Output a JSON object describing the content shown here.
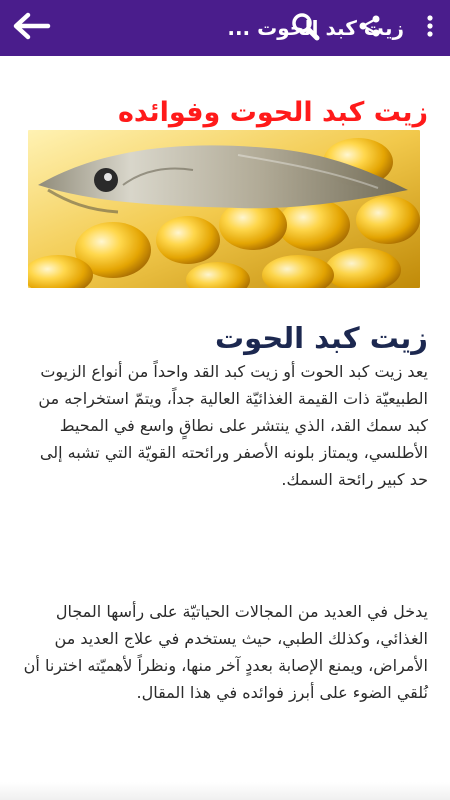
{
  "app_bar": {
    "title": "زيت كبد الحوت ...",
    "icons": {
      "back": "arrow-left-icon",
      "share": "share-icon",
      "search": "search-icon",
      "menu": "more-vert-icon"
    },
    "colors": {
      "bar": "#4a1d8c",
      "icon": "#ffffff"
    }
  },
  "article": {
    "heading_red": "زيت كبد الحوت وفوائده",
    "hero_image": {
      "label": "fish-and-capsules-image"
    },
    "section_heading": "زيت كبد الحوت",
    "paragraph_1": "يعد زيت كبد الحوت أو زيت كبد القد واحداً من أنواع الزيوت الطبيعيّة ذات القيمة الغذائيّة العالية جداً، ويتمّ استخراجه من كبد سمك القد، الذي ينتشر على نطاقٍ واسع في المحيط الأطلسي، ويمتاز بلونه الأصفر ورائحته القويّة التي تشبه إلى حد كبير رائحة السمك.",
    "paragraph_2": "يدخل في العديد من المجالات الحياتيّة على رأسها المجال الغذائي، وكذلك الطبي، حيث يستخدم في علاج العديد من الأمراض، ويمنع الإصابة بعددٍ آخر منها، ونظراً لأهميّته اخترنا أن نُلقي الضوء على أبرز فوائده في هذا المقال."
  },
  "colors": {
    "heading_red": "#ff1a1a",
    "heading_dark": "#1c2850",
    "body_text": "#2b2b2b"
  }
}
